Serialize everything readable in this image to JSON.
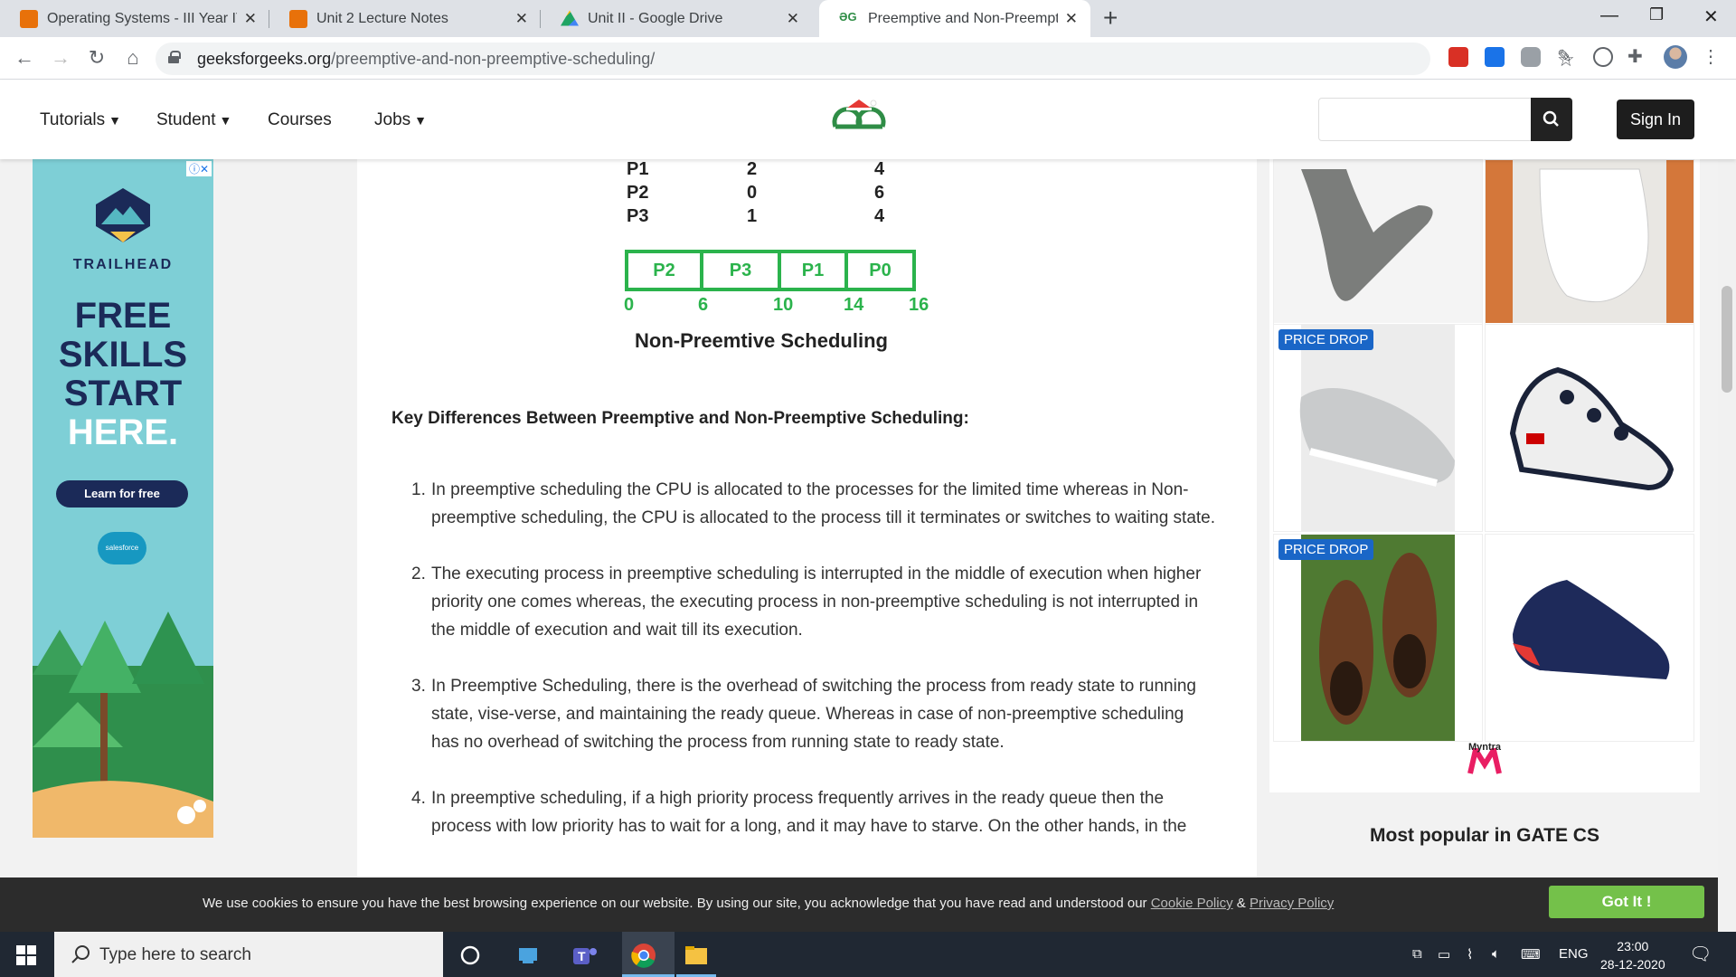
{
  "browser": {
    "tabs": [
      {
        "title": "Operating Systems - III Year IT (B.",
        "favicon_color": "#e8710a",
        "active": false
      },
      {
        "title": "Unit 2 Lecture Notes",
        "favicon_color": "#e8710a",
        "active": false
      },
      {
        "title": "Unit II - Google Drive",
        "favicon_color": "#1fa463",
        "active": false
      },
      {
        "title": "Preemptive and Non-Preemptive",
        "favicon_color": "#2f8d46",
        "active": true
      }
    ],
    "new_tab": "+",
    "url_domain": "geeksforgeeks.org",
    "url_path": "/preemptive-and-non-preemptive-scheduling/"
  },
  "site": {
    "nav": [
      "Tutorials",
      "Student",
      "Courses",
      "Jobs"
    ],
    "sign_in": "Sign In",
    "search_placeholder": ""
  },
  "left_ad": {
    "brand": "TRAILHEAD",
    "headline_1": "FREE",
    "headline_2": "SKILLS",
    "headline_3": "START",
    "headline_4": "HERE.",
    "cta": "Learn for free",
    "sponsor": "salesforce"
  },
  "article": {
    "process_rows": [
      {
        "process": "P1",
        "arrival": "2",
        "burst": "4"
      },
      {
        "process": "P2",
        "arrival": "0",
        "burst": "6"
      },
      {
        "process": "P3",
        "arrival": "1",
        "burst": "4"
      }
    ],
    "gantt": [
      "P2",
      "P3",
      "P1",
      "P0"
    ],
    "ticks": [
      "0",
      "6",
      "10",
      "14",
      "16"
    ],
    "caption": "Non-Preemtive Scheduling",
    "heading": "Key Differences Between Preemptive and Non-Preemptive Scheduling:",
    "points": [
      "In preemptive scheduling the CPU is allocated to the processes for the limited time whereas in Non-preemptive scheduling, the CPU is allocated to the process till it terminates or switches to waiting state.",
      "The executing process in preemptive scheduling is interrupted in the middle of execution when higher priority one comes whereas, the executing process in non-preemptive scheduling is not interrupted in the middle of execution and wait till its execution.",
      "In Preemptive Scheduling, there is the overhead of switching the process from ready state to running state, vise-verse, and maintaining the ready queue. Whereas in case of non-preemptive scheduling has no overhead of switching the process from running state to ready state.",
      "In preemptive scheduling, if a high priority process frequently arrives in the ready queue then the process with low priority has to wait for a long, and it may have to starve. On the other hands, in the"
    ]
  },
  "right_ad": {
    "badge": "PRICE DROP",
    "brand": "Myntra"
  },
  "sidebar": {
    "popular_title": "Most popular in GATE CS"
  },
  "cookie": {
    "text": "We use cookies to ensure you have the best browsing experience on our website. By using our site, you acknowledge that you have read and understood our",
    "cookie_policy": "Cookie Policy",
    "amp": "&",
    "privacy_policy": "Privacy Policy",
    "button": "Got It !"
  },
  "taskbar": {
    "search_placeholder": "Type here to search",
    "lang": "ENG",
    "time": "23:00",
    "date": "28-12-2020"
  },
  "colors": {
    "gfg_green": "#2f8d46",
    "gantt_green": "#2bb34c",
    "got_it_green": "#74c14a",
    "price_drop_blue": "#1a66c7"
  }
}
